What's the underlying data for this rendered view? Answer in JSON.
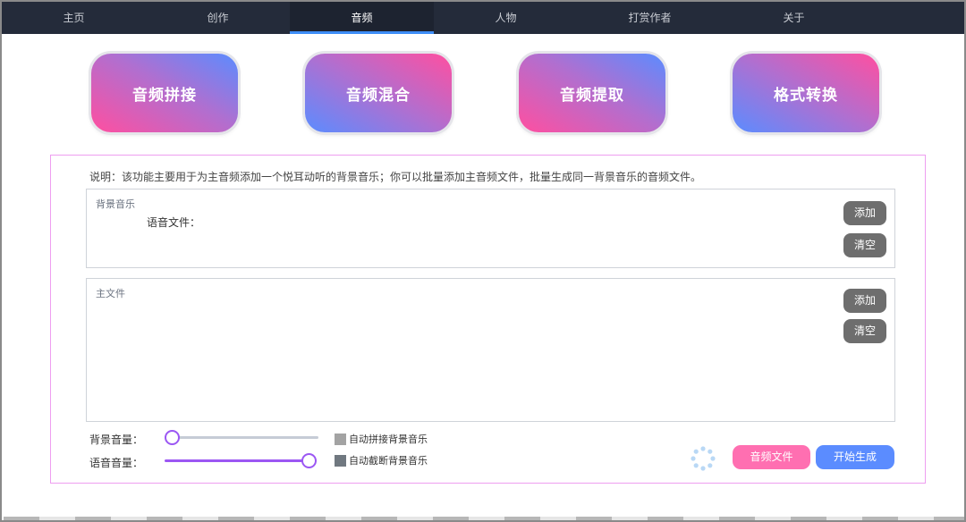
{
  "nav": {
    "tabs": [
      {
        "label": "主页"
      },
      {
        "label": "创作"
      },
      {
        "label": "音频",
        "active": true
      },
      {
        "label": "人物"
      },
      {
        "label": "打赏作者"
      },
      {
        "label": "关于"
      }
    ]
  },
  "features": {
    "concat": "音频拼接",
    "mix": "音频混合",
    "extract": "音频提取",
    "convert": "格式转换"
  },
  "panel": {
    "description": "说明：该功能主要用于为主音频添加一个悦耳动听的背景音乐；你可以批量添加主音频文件，批量生成同一背景音乐的音频文件。",
    "bgm_box": {
      "title": "背景音乐",
      "file_label": "语音文件：",
      "add_label": "添加",
      "clear_label": "清空"
    },
    "main_box": {
      "title": "主文件",
      "add_label": "添加",
      "clear_label": "清空"
    },
    "bgm_volume": {
      "label": "背景音量：",
      "value": 0
    },
    "voice_volume": {
      "label": "语音音量：",
      "value": 100
    },
    "auto_concat_bgm": {
      "label": "自动拼接背景音乐",
      "checked": false
    },
    "auto_cut_bgm": {
      "label": "自动截断背景音乐",
      "checked": false
    },
    "audio_file_button": "音频文件",
    "start_button": "开始生成"
  },
  "colors": {
    "nav_bg": "#242b3a",
    "nav_active_underline": "#3e8ef7",
    "pink": "#ff6fb1",
    "blue": "#5b8cff",
    "gray_button": "#6e6e6e",
    "slider_accent": "#9b57f3"
  }
}
